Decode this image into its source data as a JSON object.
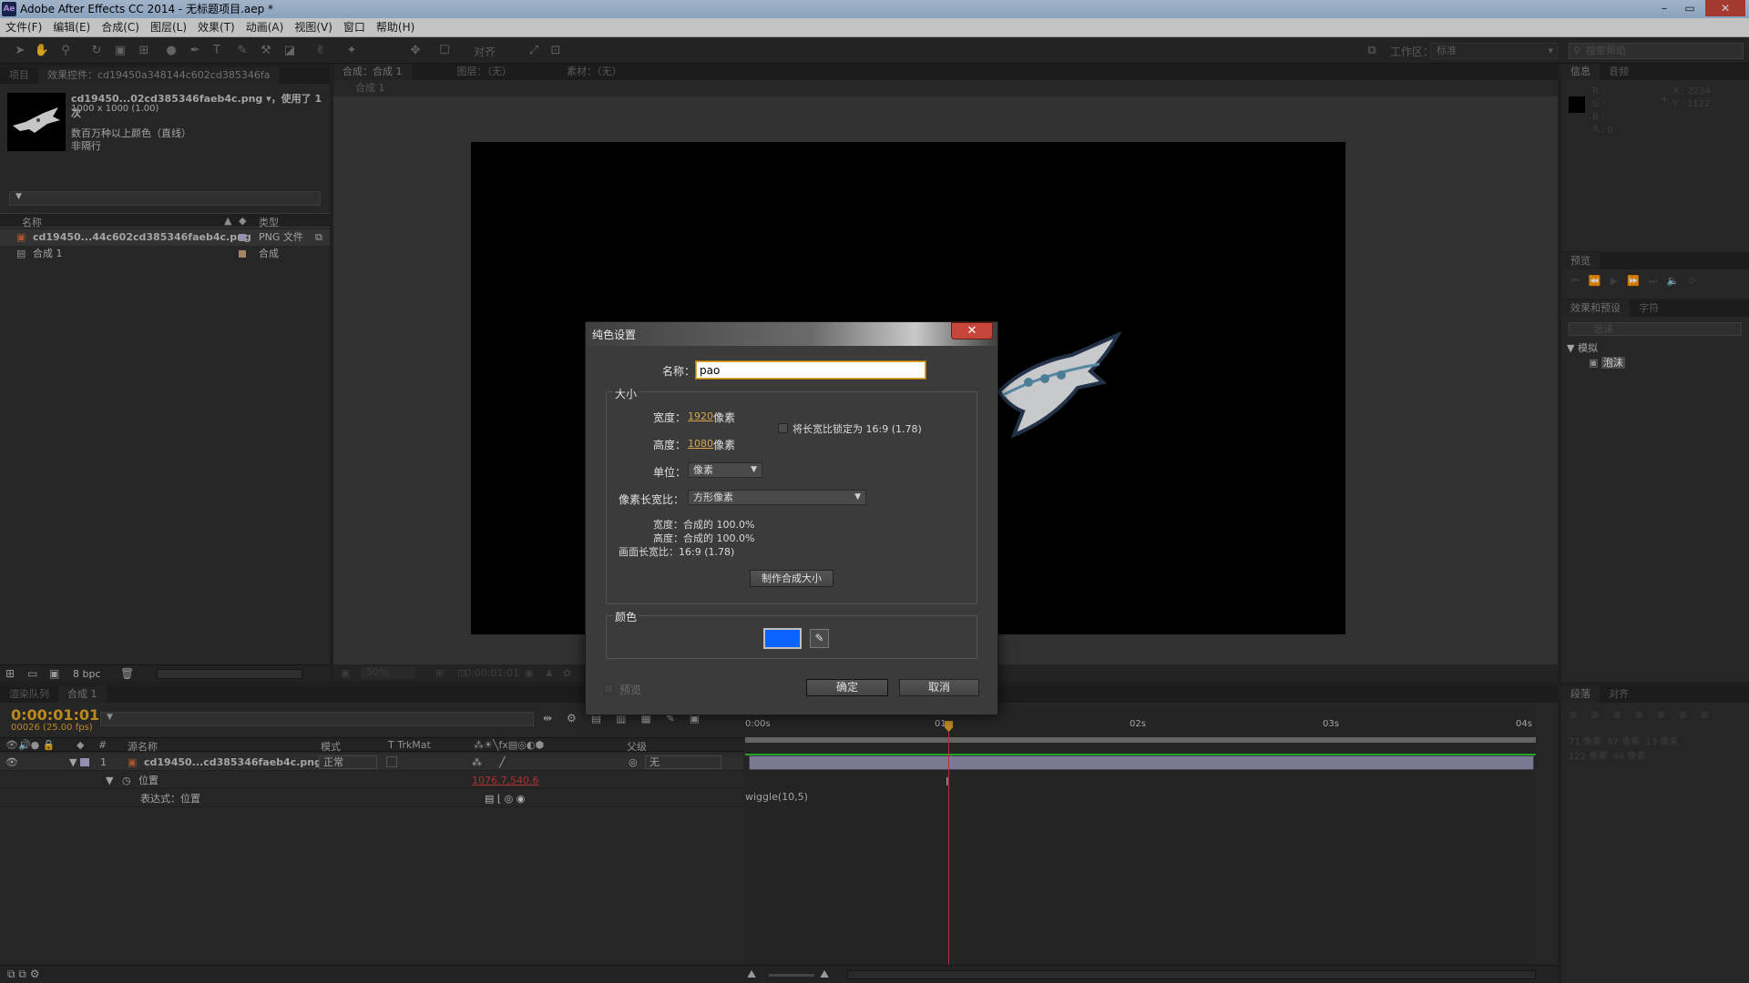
{
  "window": {
    "title": "Adobe After Effects CC 2014 - 无标题项目.aep *",
    "app_icon": "Ae",
    "controls": [
      "–",
      "▭",
      "✕"
    ]
  },
  "menu": [
    "文件(F)",
    "编辑(E)",
    "合成(C)",
    "图层(L)",
    "效果(T)",
    "动画(A)",
    "视图(V)",
    "窗口",
    "帮助(H)"
  ],
  "toolbar": {
    "snap_label": "对齐",
    "workspace_label": "工作区：",
    "workspace_value": "标准",
    "search_placeholder": "搜索帮助"
  },
  "project_panel": {
    "tabs": [
      "项目",
      "效果控件：cd19450a348144c602cd385346fa"
    ],
    "footage_name": "cd19450...02cd385346faeb4c.png ▾，使用了 1 次",
    "footage_size": "1000 x 1000 (1.00)",
    "footage_colors": "数百万种以上颜色（直线）",
    "footage_interlace": "非隔行",
    "columns": {
      "name": "名称",
      "type": "类型"
    },
    "items": [
      {
        "name": "cd19450...44c602cd385346faeb4c.png",
        "type": "PNG 文件",
        "label_color": "#b4b4d8"
      },
      {
        "name": "合成 1",
        "type": "合成",
        "label_color": "#c9a27a"
      }
    ],
    "bpc": "8 bpc"
  },
  "comp_panel": {
    "tabs": [
      "合成：合成 1",
      "图层：（无）",
      "素材：（无）"
    ],
    "breadcrumb": "合成 1",
    "zoom": "50%",
    "timecode": "0:00:01:01"
  },
  "info_panel": {
    "tabs": [
      "信息",
      "音频"
    ],
    "r": "R :",
    "g": "G :",
    "b": "B :",
    "a": "A : 0",
    "x": "X : 2234",
    "y": "Y : 1122"
  },
  "preview_panel": {
    "tabs": [
      "预览"
    ]
  },
  "effects_panel": {
    "tabs": [
      "效果和预设",
      "字符"
    ],
    "search_value": "泡沫",
    "category": "模拟",
    "effect": "泡沫"
  },
  "timeline": {
    "tabs": [
      "渲染队列",
      "合成 1"
    ],
    "timecode": "0:00:01:01",
    "timecode_sub": "00026 (25.00 fps)",
    "columns": {
      "source": "源名称",
      "mode": "模式",
      "trkmat": "T  TrkMat",
      "parent": "父级"
    },
    "layer": {
      "index": "1",
      "name": "cd19450...cd385346faeb4c.png",
      "mode": "正常",
      "parent": "无"
    },
    "property": {
      "name": "位置",
      "value": "1076.7,540.6"
    },
    "expression_label": "表达式：位置",
    "expression": "wiggle(10,5)",
    "ruler": [
      "0:00s",
      "01s",
      "02s",
      "03s",
      "04s"
    ],
    "playhead_seconds": 1.04
  },
  "paragraph_panel": {
    "tabs": [
      "段落",
      "对齐"
    ],
    "indent_left": "71 像素",
    "indent_right": "87 像素",
    "indent_first": "13 像素",
    "space_before": "122 像素",
    "space_after": "46 像素"
  },
  "dialog": {
    "title": "纯色设置",
    "name_label": "名称：",
    "name_value": "pao",
    "size_group": "大小",
    "width_label": "宽度：",
    "width_value": "1920",
    "height_label": "高度：",
    "height_value": "1080",
    "px_unit": "像素",
    "lock_ratio_label": "将长宽比锁定为 16:9 (1.78)",
    "units_label": "单位：",
    "units_value": "像素",
    "par_label": "像素长宽比：",
    "par_value": "方形像素",
    "width_pct": "宽度：合成的 100.0%",
    "height_pct": "高度：合成的 100.0%",
    "frame_ratio": "画面长宽比：16:9 (1.78)",
    "make_comp_size": "制作合成大小",
    "color_group": "颜色",
    "color_value": "#0a62ff",
    "preview_label": "预览",
    "ok": "确定",
    "cancel": "取消"
  }
}
